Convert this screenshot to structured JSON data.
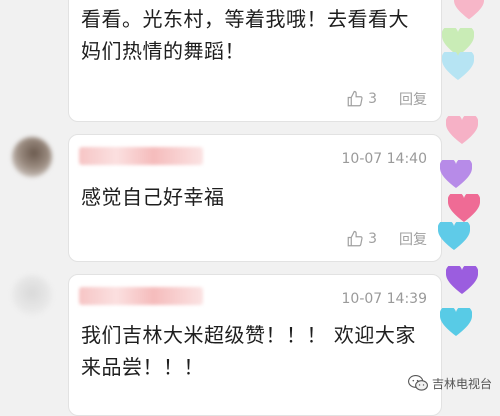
{
  "comments": [
    {
      "text_lines": [
        "看看。光东村，等着我哦！去看看大",
        "妈们热情的舞蹈！"
      ],
      "likes": "3",
      "reply_label": "回复"
    },
    {
      "timestamp": "10-07 14:40",
      "text_lines": [
        "感觉自己好幸福"
      ],
      "likes": "3",
      "reply_label": "回复"
    },
    {
      "timestamp": "10-07 14:39",
      "text_lines": [
        "我们吉林大米超级赞！！！ 欢迎大家",
        "来品尝！！！"
      ]
    }
  ],
  "watermark": "吉林电视台",
  "colors": {
    "card_bg": "#ffffff",
    "page_bg": "#f1f1f1",
    "meta_text": "#9a9a9a",
    "username_blur": "#f6c5c5"
  },
  "hearts": [
    {
      "color": "#f7b6c8"
    },
    {
      "color": "#c9ecb6"
    },
    {
      "color": "#b6e4f3"
    },
    {
      "color": "#f6b1c6"
    },
    {
      "color": "#b78be8"
    },
    {
      "color": "#ef6b95"
    },
    {
      "color": "#5fcbe8"
    },
    {
      "color": "#9b5ddf"
    },
    {
      "color": "#58cbe6"
    }
  ]
}
